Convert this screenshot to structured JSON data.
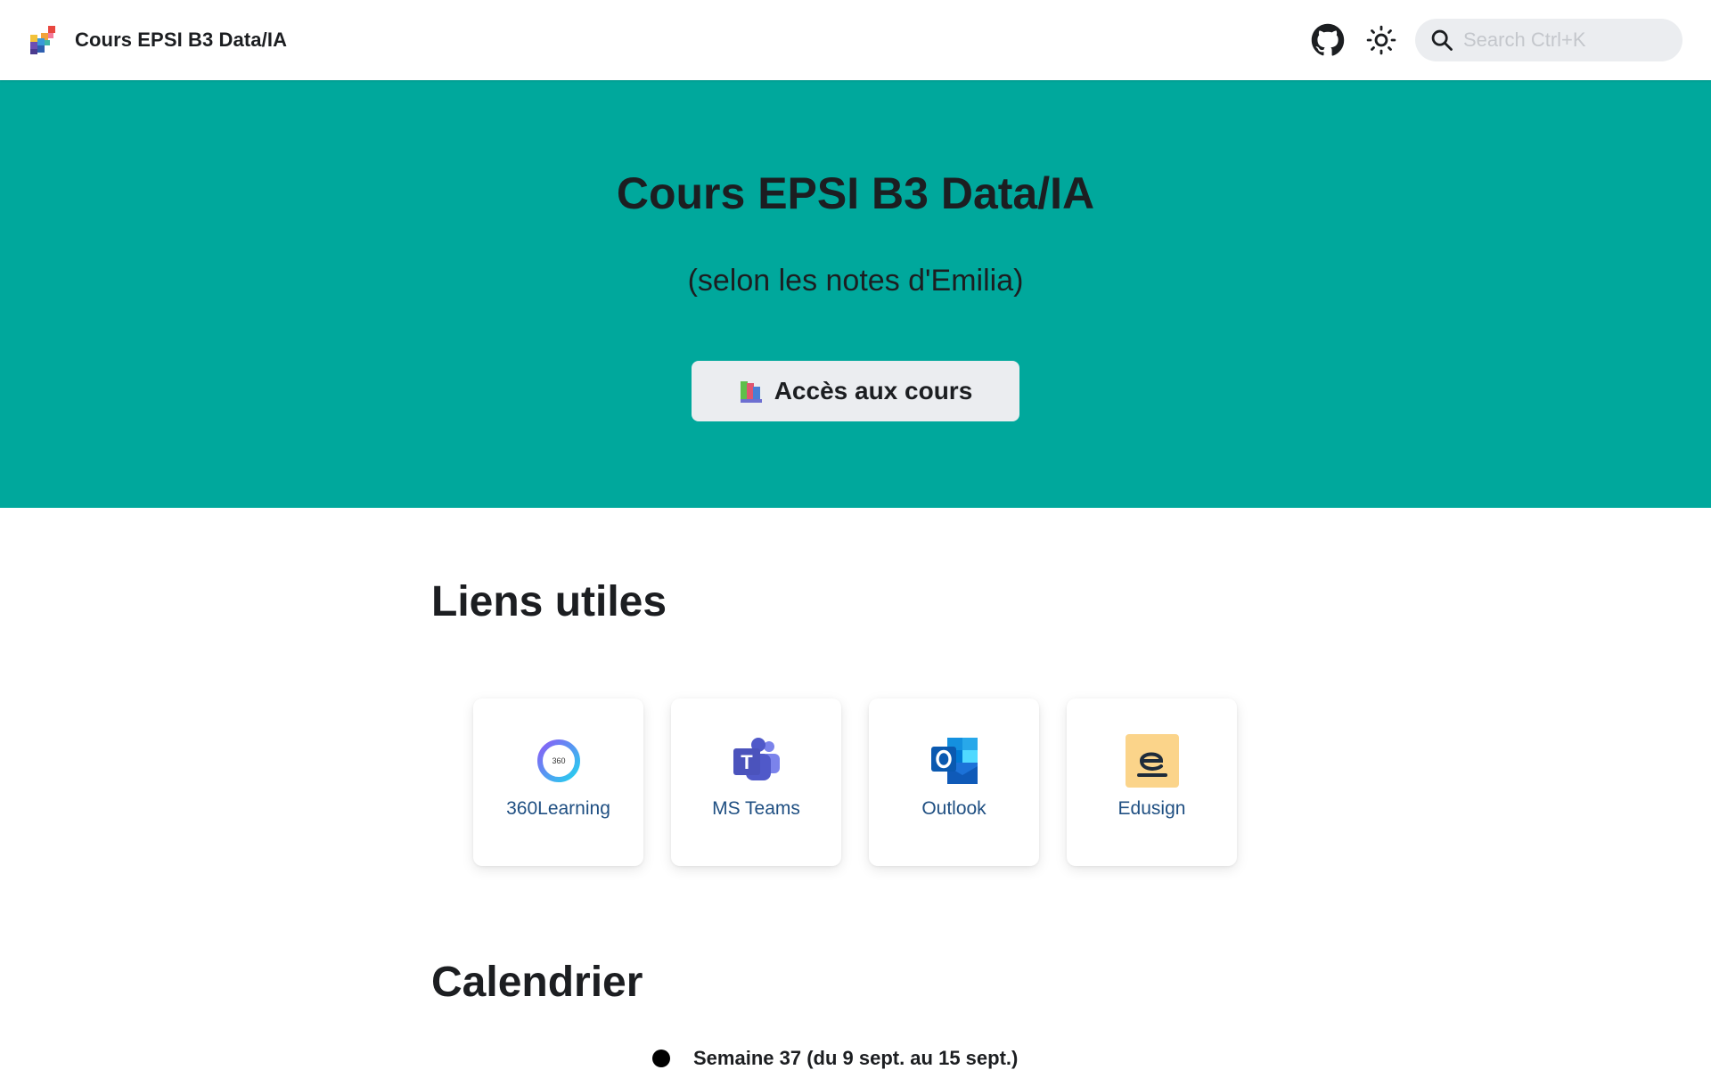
{
  "navbar": {
    "title": "Cours EPSI B3 Data/IA",
    "logo_icon": "pixel-mosaic-logo-icon",
    "github_icon": "github-icon",
    "theme_icon": "sun-icon",
    "search": {
      "placeholder": "Search Ctrl+K"
    }
  },
  "hero": {
    "background": "#00a89c",
    "title": "Cours EPSI B3 Data/IA",
    "subtitle": "(selon les notes d'Emilia)",
    "button": {
      "icon": "books-icon",
      "label": "Accès aux cours"
    }
  },
  "links": {
    "title": "Liens utiles",
    "cards": [
      {
        "label": "360Learning",
        "icon": "360learning-icon"
      },
      {
        "label": "MS Teams",
        "icon": "ms-teams-icon"
      },
      {
        "label": "Outlook",
        "icon": "outlook-icon"
      },
      {
        "label": "Edusign",
        "icon": "edusign-icon"
      }
    ]
  },
  "calendar": {
    "title": "Calendrier",
    "items": [
      {
        "label": "Semaine 37 (du 9 sept. au 15 sept.)"
      }
    ]
  },
  "colors": {
    "link": "#1f4f82",
    "search_bg": "#ebedf0"
  }
}
